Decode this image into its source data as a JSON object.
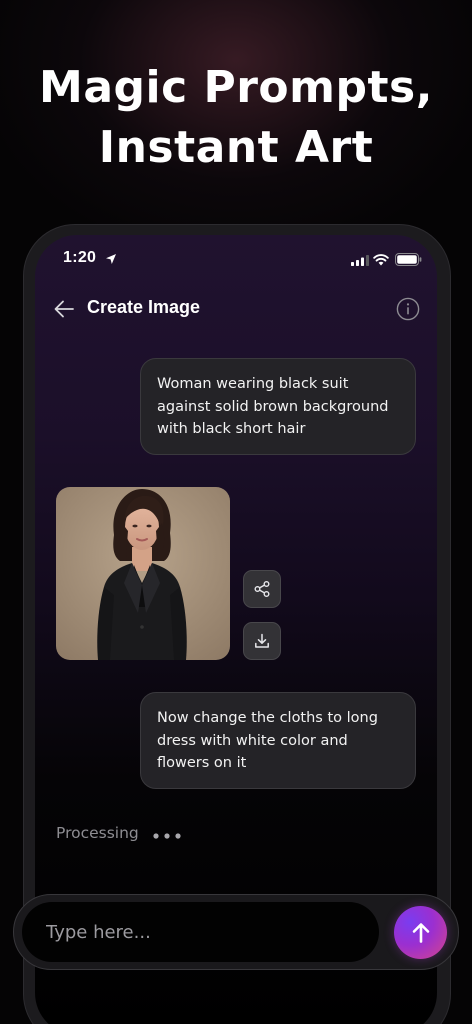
{
  "headline": {
    "line1": "Magic Prompts,",
    "line2": "Instant Art"
  },
  "status_bar": {
    "time": "1:20",
    "icons": [
      "location-arrow-icon",
      "signal-icon",
      "wifi-icon",
      "battery-icon"
    ]
  },
  "header": {
    "title": "Create Image",
    "icons": [
      "back-arrow-icon",
      "info-icon"
    ]
  },
  "messages": [
    {
      "role": "user",
      "text": "Woman wearing black suit against solid brown background with black short hair"
    },
    {
      "role": "assistant",
      "type": "image",
      "actions": [
        "share-icon",
        "download-icon"
      ]
    },
    {
      "role": "user",
      "text": "Now change the cloths to long dress with white color and flowers on it"
    }
  ],
  "status": {
    "processing": "Processing"
  },
  "composer": {
    "placeholder": "Type here...",
    "send_icon": "arrow-up-icon"
  },
  "colors": {
    "send_gradient_start": "#7a3cf0",
    "send_gradient_end": "#d6458a",
    "bubble_bg": "#242327"
  }
}
